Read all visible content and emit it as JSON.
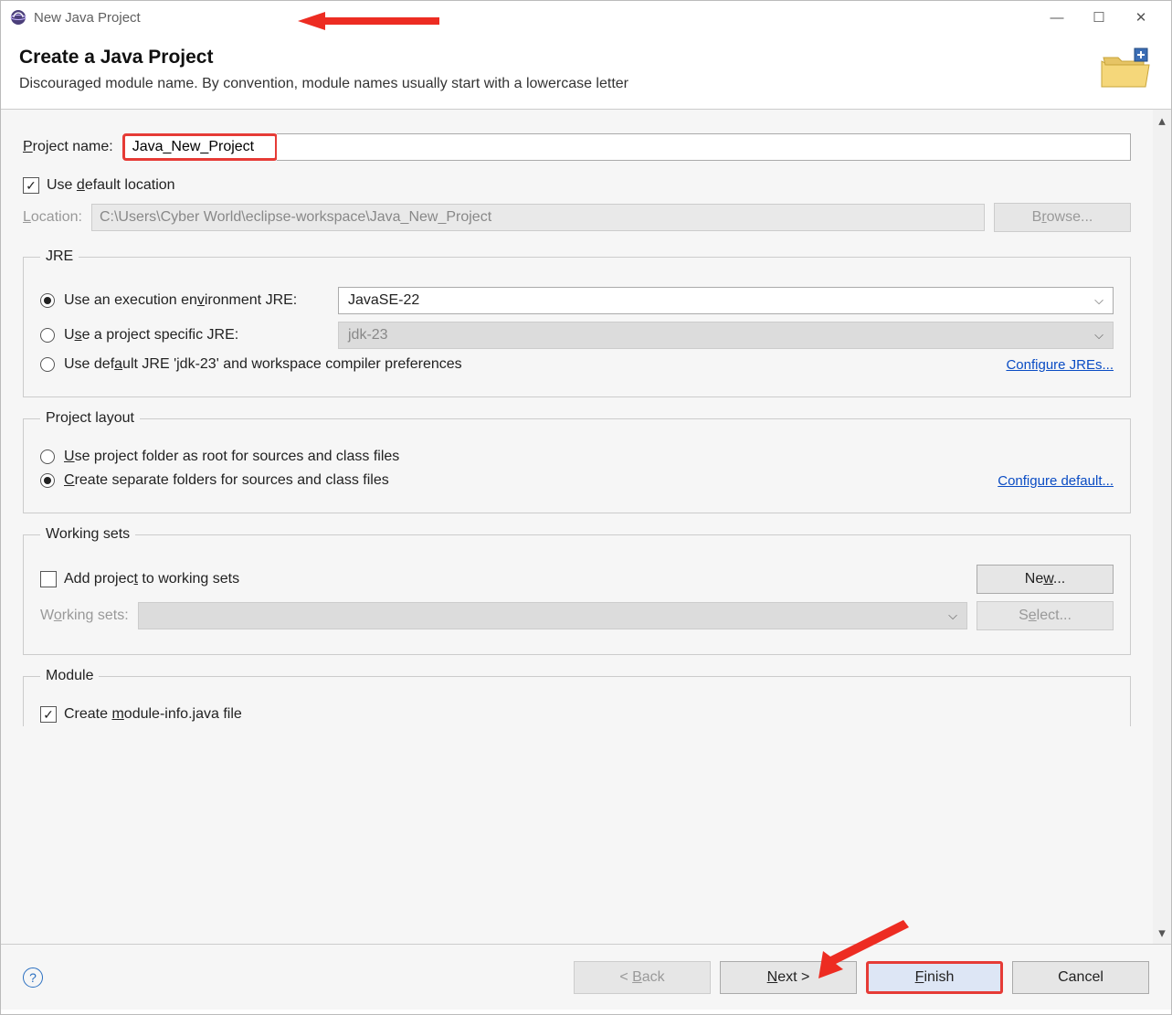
{
  "window": {
    "title": "New Java Project"
  },
  "header": {
    "title": "Create a Java Project",
    "subtitle": "Discouraged module name. By convention, module names usually start with a lowercase letter"
  },
  "projectName": {
    "label": "Project name:",
    "value": "Java_New_Project"
  },
  "defaultLocation": {
    "checkbox_label": "Use default location",
    "location_label": "Location:",
    "location_value": "C:\\Users\\Cyber World\\eclipse-workspace\\Java_New_Project",
    "browse": "Browse..."
  },
  "jre": {
    "legend": "JRE",
    "opt1": "Use an execution environment JRE:",
    "opt1_value": "JavaSE-22",
    "opt2": "Use a project specific JRE:",
    "opt2_value": "jdk-23",
    "opt3": "Use default JRE 'jdk-23' and workspace compiler preferences",
    "configure": "Configure JREs..."
  },
  "layout": {
    "legend": "Project layout",
    "opt1": "Use project folder as root for sources and class files",
    "opt2": "Create separate folders for sources and class files",
    "configure": "Configure default..."
  },
  "workingSets": {
    "legend": "Working sets",
    "checkbox_label": "Add project to working sets",
    "new": "New...",
    "label": "Working sets:",
    "select": "Select..."
  },
  "module": {
    "legend": "Module",
    "checkbox_label": "Create module-info.java file"
  },
  "footer": {
    "back": "< Back",
    "next": "Next >",
    "finish": "Finish",
    "cancel": "Cancel"
  }
}
